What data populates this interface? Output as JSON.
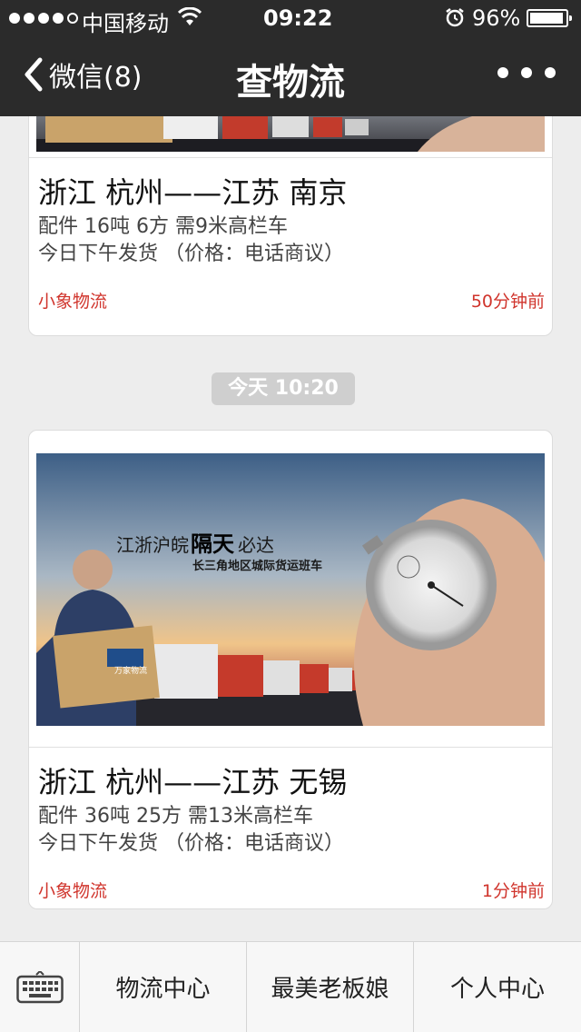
{
  "status_bar": {
    "carrier": "中国移动",
    "time": "09:22",
    "battery_percent": "96%",
    "battery_level": 0.96,
    "icons": [
      "signal-dots-icon",
      "wifi-icon",
      "alarm-icon",
      "battery-icon"
    ]
  },
  "nav": {
    "back_label": "微信(8)",
    "title": "查物流",
    "more_icon": "more-dots-icon"
  },
  "feed": {
    "items": [
      {
        "route": "浙江  杭州——江苏  南京",
        "cargo": "配件  16吨  6方  需9米高栏车",
        "schedule": "今日下午发货    （价格：电话商议）",
        "company": "小象物流",
        "time_ago": "50分钟前"
      },
      {
        "banner": {
          "headline_prefix": "江浙沪皖",
          "headline_bold": "隔天",
          "headline_suffix": "必达",
          "subline": "长三角地区城际货运班车",
          "brand": "万家物流"
        },
        "route": "浙江  杭州——江苏  无锡",
        "cargo": "配件  36吨  25方  需13米高栏车",
        "schedule": "今日下午发货    （价格：电话商议）",
        "company": "小象物流",
        "time_ago": "1分钟前"
      }
    ],
    "timestamp_pill": "今天  10:20"
  },
  "tabbar": {
    "keyboard_icon": "keyboard-icon",
    "tabs": [
      "物流中心",
      "最美老板娘",
      "个人中心"
    ]
  },
  "colors": {
    "bar_dark": "#2b2b2b",
    "accent_red": "#d0342c",
    "background": "#ededed"
  }
}
